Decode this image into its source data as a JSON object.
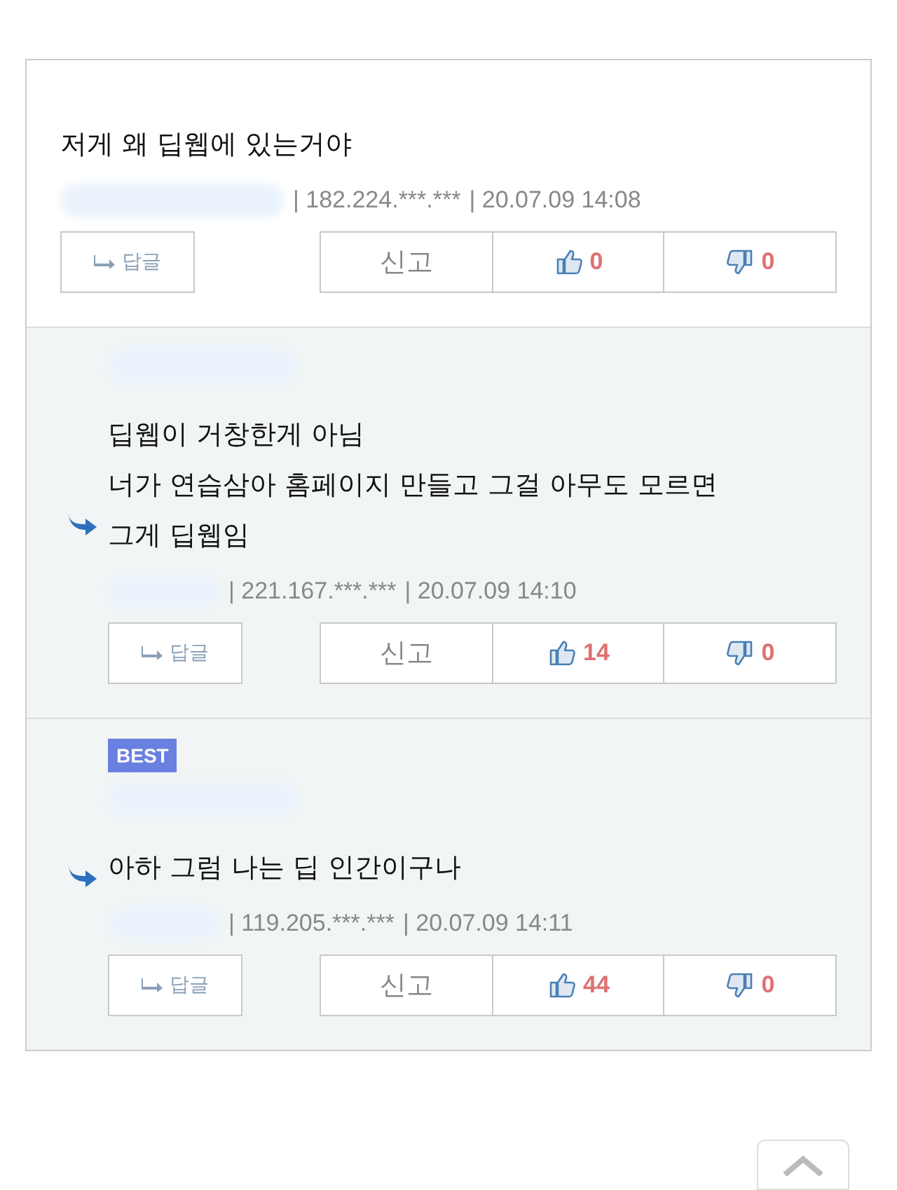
{
  "comments": [
    {
      "is_reply": false,
      "best": false,
      "lines": [
        "저게 왜 딥웹에 있는거야"
      ],
      "ip": "| 182.224.***.***",
      "time": "| 20.07.09 14:08",
      "reply_label": "답글",
      "report_label": "신고",
      "likes": "0",
      "dislikes": "0"
    },
    {
      "is_reply": true,
      "best": false,
      "lines": [
        "딥웹이 거창한게 아님",
        "너가 연습삼아 홈페이지 만들고 그걸 아무도 모르면",
        "그게 딥웹임"
      ],
      "ip": "| 221.167.***.***",
      "time": "| 20.07.09 14:10",
      "reply_label": "답글",
      "report_label": "신고",
      "likes": "14",
      "dislikes": "0"
    },
    {
      "is_reply": true,
      "best": true,
      "best_label": "BEST",
      "lines": [
        "아하 그럼 나는 딥 인간이구나"
      ],
      "ip": "| 119.205.***.***",
      "time": "| 20.07.09 14:11",
      "reply_label": "답글",
      "report_label": "신고",
      "likes": "44",
      "dislikes": "0"
    }
  ]
}
